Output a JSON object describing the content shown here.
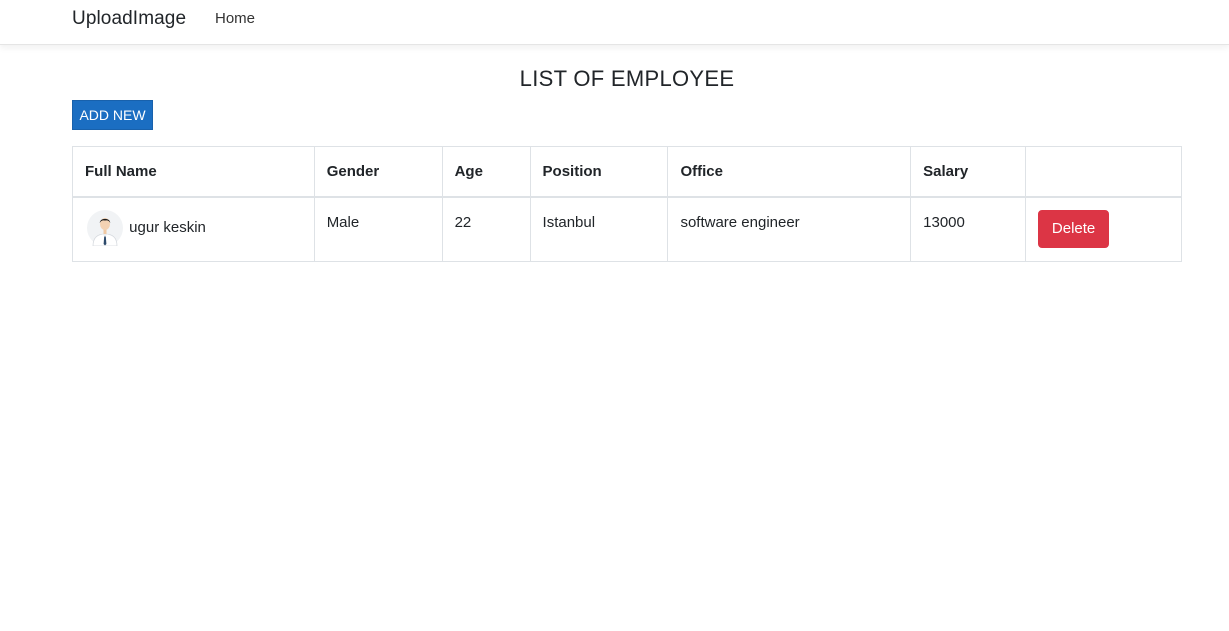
{
  "navbar": {
    "brand": "UploadImage",
    "links": [
      {
        "label": "Home"
      }
    ]
  },
  "main": {
    "title": "LIST OF EMPLOYEE",
    "add_button_label": "ADD NEW"
  },
  "table": {
    "columns": [
      "Full Name",
      "Gender",
      "Age",
      "Position",
      "Office",
      "Salary",
      ""
    ],
    "rows": [
      {
        "avatar_icon": "person-avatar-icon",
        "full_name": "ugur keskin",
        "gender": "Male",
        "age": "22",
        "position": "Istanbul",
        "office": "software engineer",
        "salary": "13000",
        "action_label": "Delete"
      }
    ]
  },
  "colors": {
    "primary": "#1b6ec2",
    "danger": "#dc3545",
    "border": "#dee2e6"
  }
}
